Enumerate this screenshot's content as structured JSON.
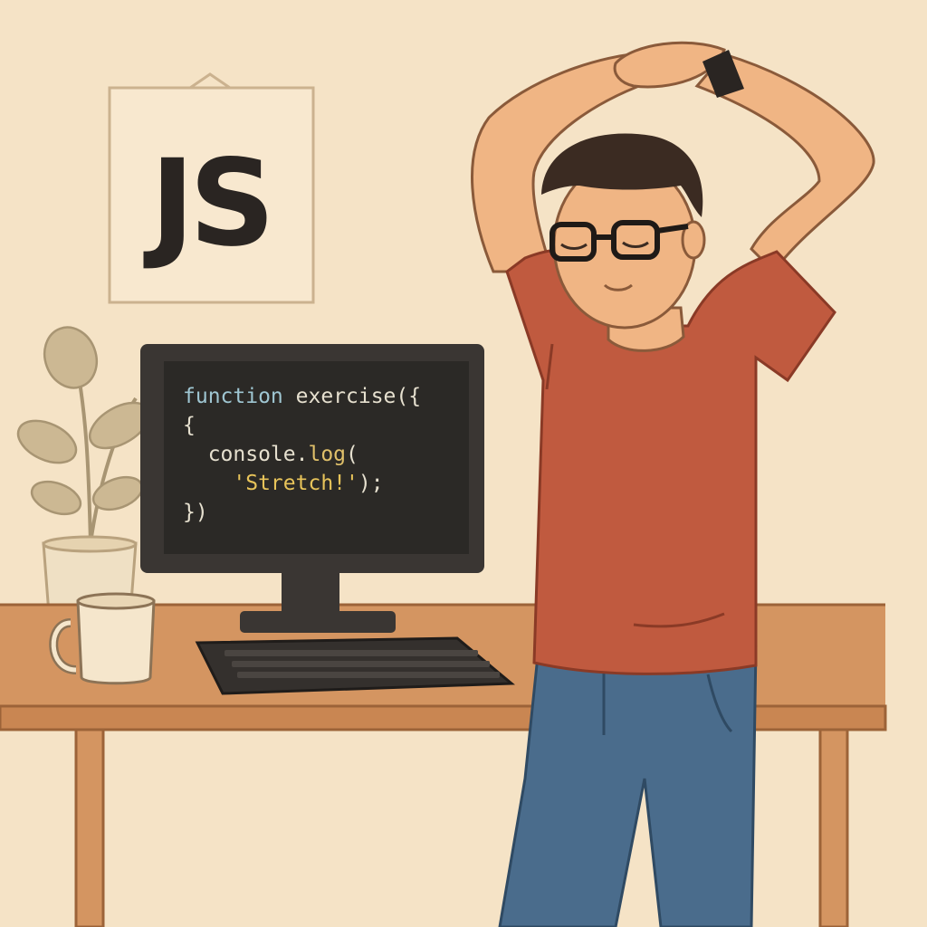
{
  "poster": {
    "text": "JS"
  },
  "monitor": {
    "code_lines": [
      [
        {
          "t": "function ",
          "c": "kw"
        },
        {
          "t": "exercise({",
          "c": "fn"
        }
      ],
      [
        {
          "t": "{",
          "c": "punc"
        }
      ],
      [
        {
          "t": "  console.",
          "c": "fn"
        },
        {
          "t": "log",
          "c": "meth"
        },
        {
          "t": "(",
          "c": "punc"
        }
      ],
      [
        {
          "t": "    ",
          "c": "punc"
        },
        {
          "t": "'Stretch!'",
          "c": "str"
        },
        {
          "t": ");",
          "c": "punc"
        }
      ],
      [
        {
          "t": "})",
          "c": "punc"
        }
      ]
    ]
  },
  "colors": {
    "wall": "#f5e3c6",
    "desk": "#d49561",
    "desk_edge": "#b8764a",
    "shirt": "#c05a3f",
    "jeans": "#4a6c8c",
    "skin": "#f0b584",
    "hair": "#3b2b22",
    "screen": "#2b2926",
    "monitor": "#3a3633",
    "mug": "#f5e6cc",
    "plant": "#c9b592"
  }
}
